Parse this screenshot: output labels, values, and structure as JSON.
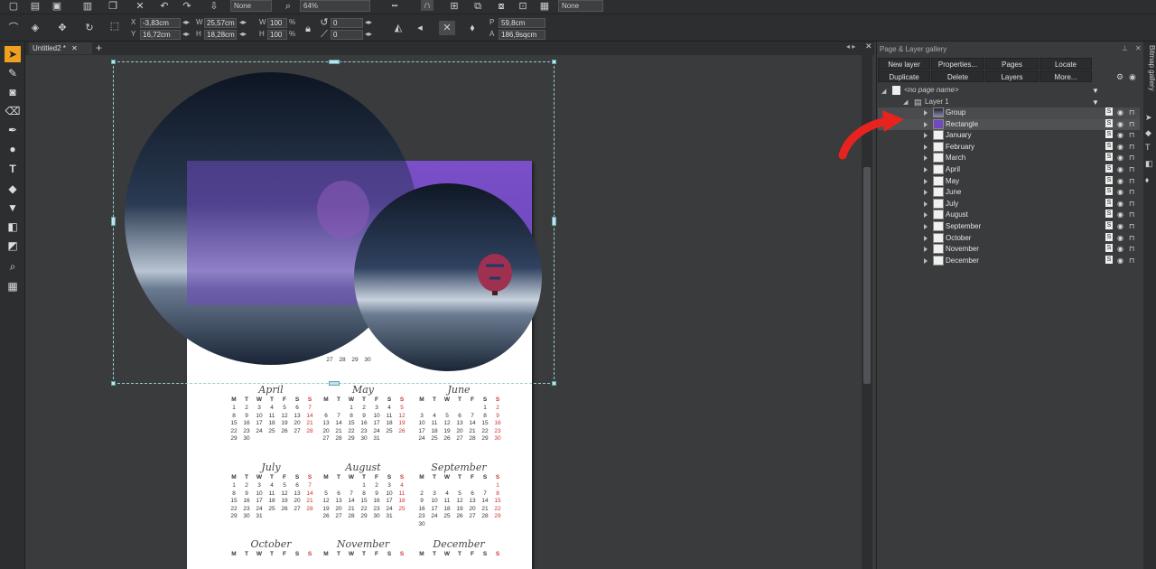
{
  "toolbar": {
    "x_label": "X",
    "x_value": "-3,83cm",
    "y_label": "Y",
    "y_value": "16,72cm",
    "w_label": "W",
    "w_value": "25,57cm",
    "h_label": "H",
    "h_value": "18,28cm",
    "wp_label": "W",
    "wp_value": "100",
    "hp_label": "H",
    "hp_value": "100",
    "pct": "%",
    "rot_value": "0",
    "skew_value": "0",
    "p_label": "P",
    "p_value": "59,8cm",
    "a_label": "A",
    "a_value": "186,9sqcm",
    "blend_dd": "None",
    "zoom_dd": "64%",
    "fill_dd": "None"
  },
  "tabs": [
    {
      "label": "Untitled2 *"
    }
  ],
  "panel": {
    "title": "Page & Layer gallery",
    "buttons_row1": [
      "New layer",
      "Properties...",
      "Pages",
      "Locate"
    ],
    "buttons_row2": [
      "Duplicate",
      "Delete",
      "Layers",
      "More..."
    ],
    "page_name": "<no page name>",
    "layer_name": "Layer 1",
    "items": [
      "Group",
      "Rectangle",
      "January",
      "February",
      "March",
      "April",
      "May",
      "June",
      "July",
      "August",
      "September",
      "October",
      "November",
      "December"
    ]
  },
  "side_tab": "Bitmap gallery",
  "calendar": {
    "day_headers": [
      "M",
      "T",
      "W",
      "T",
      "F",
      "S",
      "S"
    ],
    "row1": [
      {
        "name": "April",
        "days": [
          "1",
          "2",
          "3",
          "4",
          "5",
          "6",
          "7",
          "8",
          "9",
          "10",
          "11",
          "12",
          "13",
          "14",
          "15",
          "16",
          "17",
          "18",
          "19",
          "20",
          "21",
          "22",
          "23",
          "24",
          "25",
          "26",
          "27",
          "28",
          "29",
          "30"
        ],
        "offset": 0
      },
      {
        "name": "May",
        "days": [
          "1",
          "2",
          "3",
          "4",
          "5",
          "6",
          "7",
          "8",
          "9",
          "10",
          "11",
          "12",
          "13",
          "14",
          "15",
          "16",
          "17",
          "18",
          "19",
          "20",
          "21",
          "22",
          "23",
          "24",
          "25",
          "26",
          "27",
          "28",
          "29",
          "30",
          "31"
        ],
        "offset": 2
      },
      {
        "name": "June",
        "days": [
          "1",
          "2",
          "3",
          "4",
          "5",
          "6",
          "7",
          "8",
          "9",
          "10",
          "11",
          "12",
          "13",
          "14",
          "15",
          "16",
          "17",
          "18",
          "19",
          "20",
          "21",
          "22",
          "23",
          "24",
          "25",
          "26",
          "27",
          "28",
          "29",
          "30"
        ],
        "offset": 5
      }
    ],
    "row2": [
      {
        "name": "July",
        "days": [
          "1",
          "2",
          "3",
          "4",
          "5",
          "6",
          "7",
          "8",
          "9",
          "10",
          "11",
          "12",
          "13",
          "14",
          "15",
          "16",
          "17",
          "18",
          "19",
          "20",
          "21",
          "22",
          "23",
          "24",
          "25",
          "26",
          "27",
          "28",
          "29",
          "30",
          "31"
        ],
        "offset": 0
      },
      {
        "name": "August",
        "days": [
          "1",
          "2",
          "3",
          "4",
          "5",
          "6",
          "7",
          "8",
          "9",
          "10",
          "11",
          "12",
          "13",
          "14",
          "15",
          "16",
          "17",
          "18",
          "19",
          "20",
          "21",
          "22",
          "23",
          "24",
          "25",
          "26",
          "27",
          "28",
          "29",
          "30",
          "31"
        ],
        "offset": 3
      },
      {
        "name": "September",
        "days": [
          "1",
          "2",
          "3",
          "4",
          "5",
          "6",
          "7",
          "8",
          "9",
          "10",
          "11",
          "12",
          "13",
          "14",
          "15",
          "16",
          "17",
          "18",
          "19",
          "20",
          "21",
          "22",
          "23",
          "24",
          "25",
          "26",
          "27",
          "28",
          "29",
          "30"
        ],
        "offset": 6
      }
    ],
    "row3": [
      {
        "name": "October"
      },
      {
        "name": "November"
      },
      {
        "name": "December"
      }
    ],
    "partial_row": [
      "27",
      "28",
      "29",
      "30"
    ]
  },
  "colors": {
    "accent": "#f0a020",
    "purple": "#7048c0",
    "arrow": "#e8231f"
  }
}
